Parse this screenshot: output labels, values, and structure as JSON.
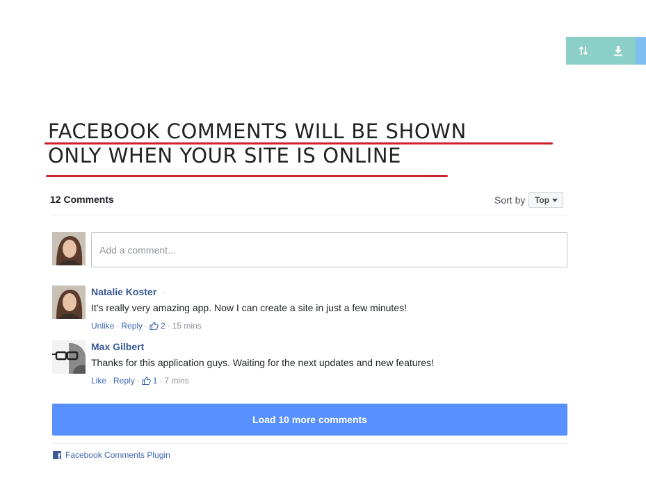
{
  "toolbar": {
    "buttons": [
      {
        "icon": "sort-arrows-icon"
      },
      {
        "icon": "download-icon"
      }
    ]
  },
  "notice": {
    "line1": "FACEBOOK COMMENTS WILL BE SHOWN",
    "line2": "ONLY WHEN YOUR SITE IS ONLINE",
    "underline_color": "#d0202a"
  },
  "comments_plugin": {
    "count_label": "12 Comments",
    "sort_label": "Sort by",
    "sort_value": "Top",
    "input_placeholder": "Add a comment...",
    "comments": [
      {
        "author": "Natalie Koster",
        "separator": "·",
        "text": "It's really very amazing app. Now I can create a site in just a few minutes!",
        "like_action": "Unlike",
        "reply_action": "Reply",
        "likes": "2",
        "time": "15 mins"
      },
      {
        "author": "Max Gilbert",
        "text": "Thanks for this application guys. Waiting for the next updates and new features!",
        "like_action": "Like",
        "reply_action": "Reply",
        "likes": "1",
        "time": "7 mins"
      }
    ],
    "load_more_label": "Load 10 more comments",
    "footer_label": "Facebook Comments Plugin"
  },
  "colors": {
    "accent_button": "#5890ff",
    "link": "#365899",
    "toolbar": "#8ccfc7"
  }
}
